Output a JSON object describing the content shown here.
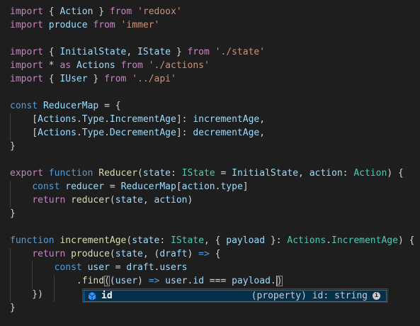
{
  "editor": {
    "lines": [
      {
        "tokens": [
          [
            "kw2",
            "import"
          ],
          [
            "punc",
            " { "
          ],
          [
            "var",
            "Action"
          ],
          [
            "punc",
            " } "
          ],
          [
            "kw2",
            "from"
          ],
          [
            "punc",
            " "
          ],
          [
            "str",
            "'redoox'"
          ]
        ]
      },
      {
        "tokens": [
          [
            "kw2",
            "import"
          ],
          [
            "punc",
            " "
          ],
          [
            "var",
            "produce"
          ],
          [
            "punc",
            " "
          ],
          [
            "kw2",
            "from"
          ],
          [
            "punc",
            " "
          ],
          [
            "str",
            "'immer'"
          ]
        ]
      },
      {
        "tokens": []
      },
      {
        "tokens": [
          [
            "kw2",
            "import"
          ],
          [
            "punc",
            " { "
          ],
          [
            "var",
            "InitialState"
          ],
          [
            "punc",
            ", "
          ],
          [
            "var",
            "IState"
          ],
          [
            "punc",
            " } "
          ],
          [
            "kw2",
            "from"
          ],
          [
            "punc",
            " "
          ],
          [
            "str",
            "'./state'"
          ]
        ]
      },
      {
        "tokens": [
          [
            "kw2",
            "import"
          ],
          [
            "punc",
            " * "
          ],
          [
            "kw2",
            "as"
          ],
          [
            "punc",
            " "
          ],
          [
            "var",
            "Actions"
          ],
          [
            "punc",
            " "
          ],
          [
            "kw2",
            "from"
          ],
          [
            "punc",
            " "
          ],
          [
            "str",
            "'./actions'"
          ]
        ]
      },
      {
        "tokens": [
          [
            "kw2",
            "import"
          ],
          [
            "punc",
            " { "
          ],
          [
            "var",
            "IUser"
          ],
          [
            "punc",
            " } "
          ],
          [
            "kw2",
            "from"
          ],
          [
            "punc",
            " "
          ],
          [
            "str",
            "'../api'"
          ]
        ]
      },
      {
        "tokens": []
      },
      {
        "tokens": [
          [
            "kw",
            "const"
          ],
          [
            "punc",
            " "
          ],
          [
            "var",
            "ReducerMap"
          ],
          [
            "punc",
            " = {"
          ]
        ]
      },
      {
        "tokens": [
          [
            "punc",
            "    ["
          ],
          [
            "var",
            "Actions"
          ],
          [
            "punc",
            "."
          ],
          [
            "var",
            "Type"
          ],
          [
            "punc",
            "."
          ],
          [
            "var",
            "IncrementAge"
          ],
          [
            "punc",
            "]: "
          ],
          [
            "var",
            "incrementAge"
          ],
          [
            "punc",
            ","
          ]
        ]
      },
      {
        "tokens": [
          [
            "punc",
            "    ["
          ],
          [
            "var",
            "Actions"
          ],
          [
            "punc",
            "."
          ],
          [
            "var",
            "Type"
          ],
          [
            "punc",
            "."
          ],
          [
            "var",
            "DecrementAge"
          ],
          [
            "punc",
            "]: "
          ],
          [
            "var",
            "decrementAge"
          ],
          [
            "punc",
            ","
          ]
        ]
      },
      {
        "tokens": [
          [
            "punc",
            "}"
          ]
        ]
      },
      {
        "tokens": []
      },
      {
        "tokens": [
          [
            "kw2",
            "export"
          ],
          [
            "punc",
            " "
          ],
          [
            "kw",
            "function"
          ],
          [
            "punc",
            " "
          ],
          [
            "fn",
            "Reducer"
          ],
          [
            "punc",
            "("
          ],
          [
            "var",
            "state"
          ],
          [
            "punc",
            ": "
          ],
          [
            "type",
            "IState"
          ],
          [
            "punc",
            " = "
          ],
          [
            "var",
            "InitialState"
          ],
          [
            "punc",
            ", "
          ],
          [
            "var",
            "action"
          ],
          [
            "punc",
            ": "
          ],
          [
            "type",
            "Action"
          ],
          [
            "punc",
            ") {"
          ]
        ]
      },
      {
        "tokens": [
          [
            "punc",
            "    "
          ],
          [
            "kw",
            "const"
          ],
          [
            "punc",
            " "
          ],
          [
            "var",
            "reducer"
          ],
          [
            "punc",
            " = "
          ],
          [
            "var",
            "ReducerMap"
          ],
          [
            "punc",
            "["
          ],
          [
            "var",
            "action"
          ],
          [
            "punc",
            "."
          ],
          [
            "var",
            "type"
          ],
          [
            "punc",
            "]"
          ]
        ]
      },
      {
        "tokens": [
          [
            "punc",
            "    "
          ],
          [
            "kw2",
            "return"
          ],
          [
            "punc",
            " "
          ],
          [
            "fn",
            "reducer"
          ],
          [
            "punc",
            "("
          ],
          [
            "var",
            "state"
          ],
          [
            "punc",
            ", "
          ],
          [
            "var",
            "action"
          ],
          [
            "punc",
            ")"
          ]
        ]
      },
      {
        "tokens": [
          [
            "punc",
            "}"
          ]
        ]
      },
      {
        "tokens": []
      },
      {
        "tokens": [
          [
            "kw",
            "function"
          ],
          [
            "punc",
            " "
          ],
          [
            "fn",
            "incrementAge"
          ],
          [
            "punc",
            "("
          ],
          [
            "var",
            "state"
          ],
          [
            "punc",
            ": "
          ],
          [
            "type",
            "IState"
          ],
          [
            "punc",
            ", { "
          ],
          [
            "var",
            "payload"
          ],
          [
            "punc",
            " }: "
          ],
          [
            "type",
            "Actions"
          ],
          [
            "punc",
            "."
          ],
          [
            "type",
            "IncrementAge"
          ],
          [
            "punc",
            ") {"
          ]
        ]
      },
      {
        "tokens": [
          [
            "punc",
            "    "
          ],
          [
            "kw2",
            "return"
          ],
          [
            "punc",
            " "
          ],
          [
            "fn",
            "produce"
          ],
          [
            "punc",
            "("
          ],
          [
            "var",
            "state"
          ],
          [
            "punc",
            ", ("
          ],
          [
            "var",
            "draft"
          ],
          [
            "punc",
            ") "
          ],
          [
            "kw",
            "=>"
          ],
          [
            "punc",
            " {"
          ]
        ]
      },
      {
        "tokens": [
          [
            "punc",
            "        "
          ],
          [
            "kw",
            "const"
          ],
          [
            "punc",
            " "
          ],
          [
            "var",
            "user"
          ],
          [
            "punc",
            " = "
          ],
          [
            "var",
            "draft"
          ],
          [
            "punc",
            "."
          ],
          [
            "var",
            "users"
          ]
        ]
      },
      {
        "tokens": [
          [
            "punc",
            "            ."
          ],
          [
            "fn",
            "find"
          ],
          [
            "match",
            "("
          ],
          [
            "punc",
            "("
          ],
          [
            "var",
            "user"
          ],
          [
            "punc",
            ") "
          ],
          [
            "kw",
            "=>"
          ],
          [
            "punc",
            " "
          ],
          [
            "var",
            "user"
          ],
          [
            "punc",
            "."
          ],
          [
            "var",
            "id"
          ],
          [
            "punc",
            " === "
          ],
          [
            "var",
            "payload"
          ],
          [
            "punc",
            "."
          ],
          [
            "cursor",
            ""
          ],
          [
            "match",
            ")"
          ]
        ]
      },
      {
        "tokens": [
          [
            "punc",
            "    })"
          ]
        ]
      },
      {
        "tokens": [
          [
            "punc",
            "}"
          ]
        ]
      }
    ]
  },
  "suggest": {
    "label": "id",
    "detail": "(property) id: string",
    "icon": "property-icon",
    "info_glyph": "i"
  }
}
